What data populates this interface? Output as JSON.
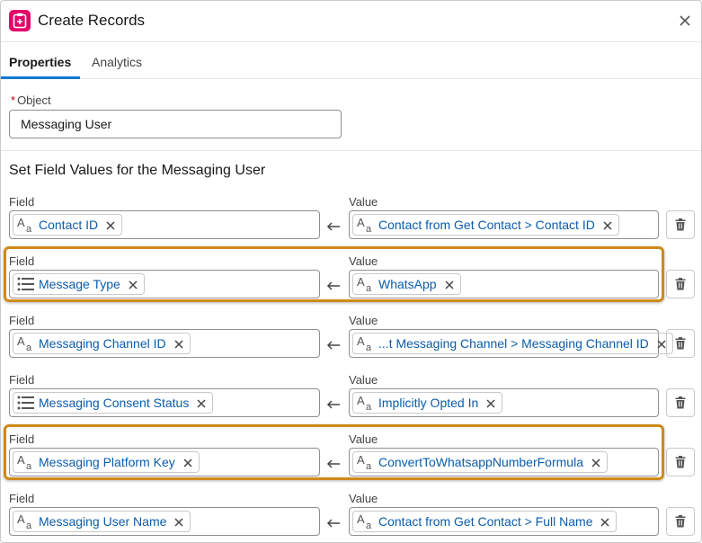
{
  "header": {
    "title": "Create Records",
    "icon": "record-create-icon"
  },
  "tabs": [
    {
      "label": "Properties",
      "active": true
    },
    {
      "label": "Analytics",
      "active": false
    }
  ],
  "object": {
    "label": "Object",
    "required_marker": "*",
    "value": "Messaging User"
  },
  "section_title": "Set Field Values for the Messaging User",
  "labels": {
    "field": "Field",
    "value": "Value"
  },
  "rows": [
    {
      "field": "Contact ID",
      "field_icon": "text-icon",
      "value": "Contact from Get Contact > Contact ID",
      "value_icon": "text-icon"
    },
    {
      "field": "Message Type",
      "field_icon": "picklist-icon",
      "value": "WhatsApp",
      "value_icon": "text-icon"
    },
    {
      "field": "Messaging Channel ID",
      "field_icon": "text-icon",
      "value": "...t Messaging Channel > Messaging Channel ID",
      "value_icon": "text-icon"
    },
    {
      "field": "Messaging Consent Status",
      "field_icon": "picklist-icon",
      "value": "Implicitly Opted In",
      "value_icon": "text-icon"
    },
    {
      "field": "Messaging Platform Key",
      "field_icon": "text-icon",
      "value": "ConvertToWhatsappNumberFormula",
      "value_icon": "text-icon"
    },
    {
      "field": "Messaging User Name",
      "field_icon": "text-icon",
      "value": "Contact from Get Contact > Full Name",
      "value_icon": "text-icon"
    }
  ],
  "colors": {
    "accent": "#0176d3",
    "link": "#0b5cab",
    "highlight": "#d08a1a",
    "icon_bg": "#e3066a"
  }
}
